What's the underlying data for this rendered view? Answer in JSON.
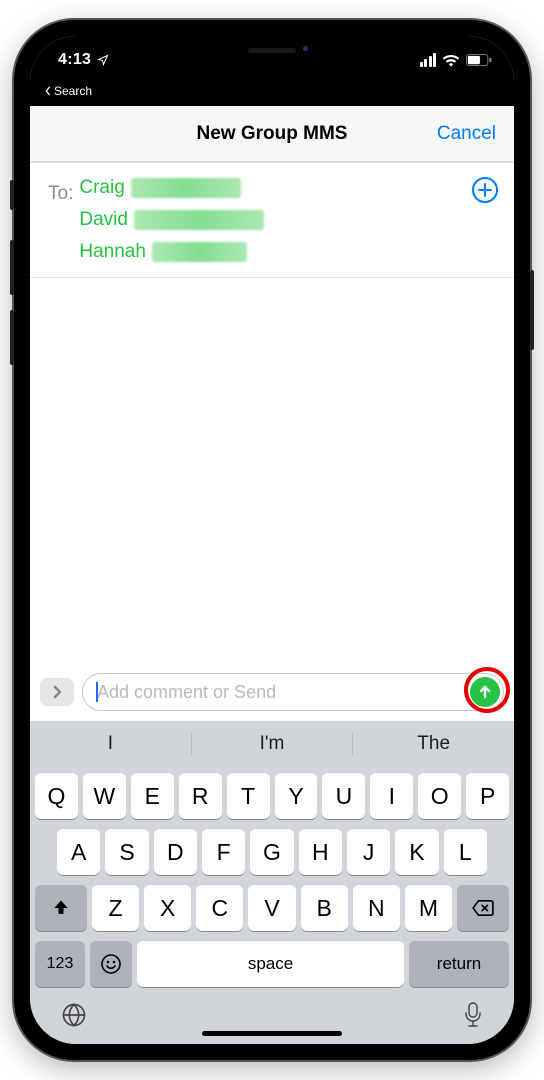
{
  "status": {
    "time": "4:13",
    "back_text": "Search"
  },
  "nav": {
    "title": "New Group MMS",
    "cancel": "Cancel"
  },
  "recipients": {
    "to_label": "To:",
    "items": [
      {
        "name": "Craig",
        "blur_w": 110
      },
      {
        "name": "David",
        "blur_w": 130
      },
      {
        "name": "Hannah",
        "blur_w": 95
      }
    ]
  },
  "compose": {
    "placeholder": "Add comment or Send"
  },
  "keyboard": {
    "suggestions": [
      "I",
      "I'm",
      "The"
    ],
    "row1": [
      "Q",
      "W",
      "E",
      "R",
      "T",
      "Y",
      "U",
      "I",
      "O",
      "P"
    ],
    "row2": [
      "A",
      "S",
      "D",
      "F",
      "G",
      "H",
      "J",
      "K",
      "L"
    ],
    "row3": [
      "Z",
      "X",
      "C",
      "V",
      "B",
      "N",
      "M"
    ],
    "num_key": "123",
    "space": "space",
    "return": "return"
  }
}
